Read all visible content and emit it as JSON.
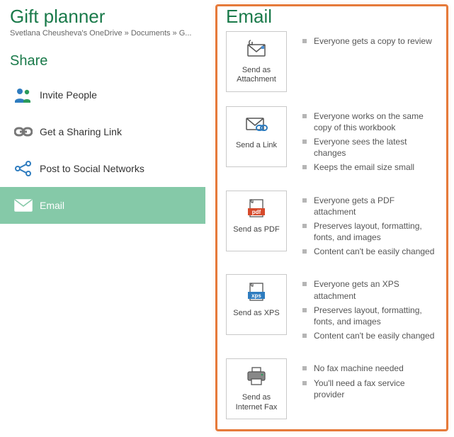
{
  "doc_title": "Gift planner",
  "breadcrumb": "Svetlana Cheusheva's OneDrive » Documents » G...",
  "share_heading": "Share",
  "share_items": [
    {
      "label": "Invite People",
      "icon": "people"
    },
    {
      "label": "Get a Sharing Link",
      "icon": "link"
    },
    {
      "label": "Post to Social Networks",
      "icon": "social"
    },
    {
      "label": "Email",
      "icon": "email",
      "selected": true
    }
  ],
  "email_heading": "Email",
  "email_options": [
    {
      "label": "Send as Attachment",
      "icon": "attach",
      "bullets": [
        "Everyone gets a copy to review"
      ]
    },
    {
      "label": "Send a Link",
      "icon": "sendlink",
      "bullets": [
        "Everyone works on the same copy of this workbook",
        "Everyone sees the latest changes",
        "Keeps the email size small"
      ]
    },
    {
      "label": "Send as PDF",
      "icon": "pdf",
      "bullets": [
        "Everyone gets a PDF attachment",
        "Preserves layout, formatting, fonts, and images",
        "Content can't be easily changed"
      ]
    },
    {
      "label": "Send as XPS",
      "icon": "xps",
      "bullets": [
        "Everyone gets an XPS attachment",
        "Preserves layout, formatting, fonts, and images",
        "Content can't be easily changed"
      ]
    },
    {
      "label": "Send as Internet Fax",
      "icon": "fax",
      "bullets": [
        "No fax machine needed",
        "You'll need a fax service provider"
      ]
    }
  ],
  "chart_data": null
}
